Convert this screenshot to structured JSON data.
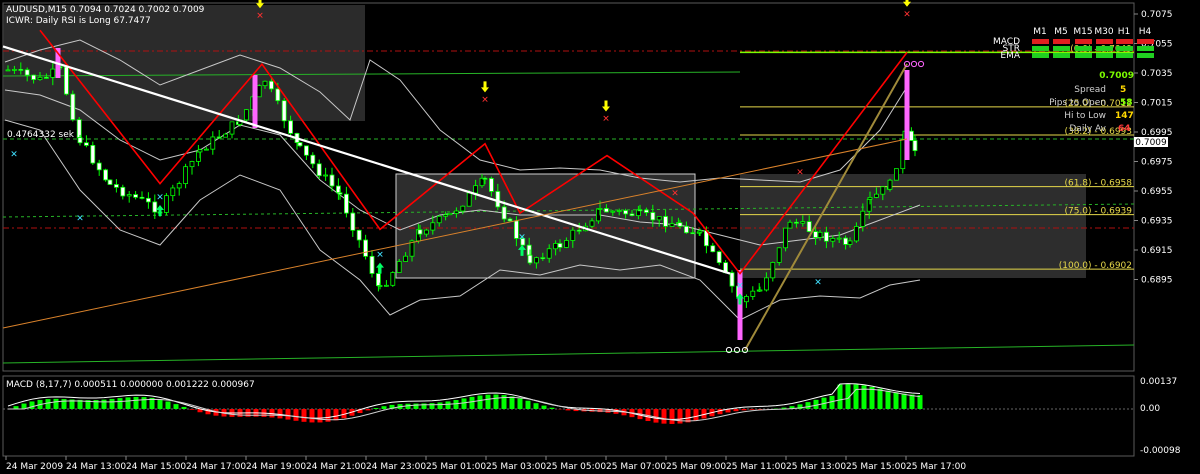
{
  "header": {
    "symbol_line": "AUDUSD,M15  0.7094 0.7024 0.7002 0.7009",
    "indicator_line": "ICWR: Daily RSI is Long 67.7477",
    "trend_label": "0.4764332 sek"
  },
  "info_panel": {
    "price": "0.7009",
    "rows": [
      {
        "label": "Spread",
        "value": "5",
        "color": "#ffd700"
      },
      {
        "label": "Pips to Open",
        "value": "58",
        "color": "#7cfc00"
      },
      {
        "label": "Hi to Low",
        "value": "147",
        "color": "#ffd700"
      },
      {
        "label": "Daily Av",
        "value": "64",
        "color": "#ff3b3b"
      }
    ],
    "matrix_cols": [
      "M1",
      "M5",
      "M15",
      "M30",
      "H1",
      "H4"
    ],
    "matrix_rows": [
      {
        "name": "MACD",
        "cells": [
          "red",
          "red",
          "red",
          "red",
          "red",
          "red"
        ]
      },
      {
        "name": "STR",
        "cells": [
          "green",
          "green",
          "green",
          "green",
          "green",
          "green"
        ]
      },
      {
        "name": "EMA",
        "cells": [
          "green",
          "green",
          "green",
          "green",
          "green",
          "green"
        ]
      }
    ]
  },
  "current_price_label": "0.7009",
  "fib_levels": [
    {
      "label": "(0.0) - 0.7049",
      "price": 0.7049
    },
    {
      "label": "(25.0) - 0.7012",
      "price": 0.7012
    },
    {
      "label": "(38.2) - 0.6993",
      "price": 0.6993
    },
    {
      "label": "(61.8) - 0.6958",
      "price": 0.6958
    },
    {
      "label": "(75.0) - 0.6939",
      "price": 0.6939
    },
    {
      "label": "(100.0) - 0.6902",
      "price": 0.6902
    }
  ],
  "macd": {
    "label": "MACD (8,17,7) 0.000511 0.000000 0.001222 0.000967",
    "axis_labels": [
      "0.00137",
      "0.00",
      "-0.00098"
    ],
    "axis_values": [
      0.00137,
      0.0,
      -0.00098
    ]
  },
  "colors": {
    "up_candle": "#000000",
    "down_candle": "#ffffff",
    "zigzag": "#ff0000",
    "trendline": "#ffffff",
    "fib_level": "#e6d84a",
    "macd_pos": "#00ff00",
    "macd_neg": "#ff0000",
    "arrow_up": "#00ff66",
    "arrow_down": "#ffff00",
    "accent_price": "#7cfc00"
  },
  "chart_data": {
    "type": "candlestick",
    "symbol": "AUDUSD",
    "timeframe": "M15",
    "ohlc_last": {
      "open": 0.7094,
      "high": 0.7024,
      "low": 0.7002,
      "close": 0.7009
    },
    "y_ticks": [
      "0.7075",
      "0.7055",
      "0.7035",
      "0.7015",
      "0.6995",
      "0.6975",
      "0.6955",
      "0.6935",
      "0.6915",
      "0.6895"
    ],
    "y_tick_values": [
      0.7075,
      0.7055,
      0.7035,
      0.7015,
      0.6995,
      0.6975,
      0.6955,
      0.6935,
      0.6915,
      0.6895
    ],
    "ylim": [
      0.6888,
      0.7082
    ],
    "x_ticks": [
      "24 Mar 2009",
      "24 Mar 13:00",
      "24 Mar 15:00",
      "24 Mar 17:00",
      "24 Mar 19:00",
      "24 Mar 21:00",
      "24 Mar 23:00",
      "25 Mar 01:00",
      "25 Mar 03:00",
      "25 Mar 05:00",
      "25 Mar 07:00",
      "25 Mar 09:00",
      "25 Mar 11:00",
      "25 Mar 13:00",
      "25 Mar 15:00",
      "25 Mar 17:00"
    ],
    "zigzag_prices": [
      0.7064,
      0.696,
      0.7041,
      0.6929,
      0.6987,
      0.694,
      0.6979,
      0.694,
      0.6899,
      0.7049
    ],
    "trendline_prices": [
      0.7053,
      0.6899
    ],
    "arrows_up_prices": [
      0.6957,
      0.6918,
      0.693,
      0.6897
    ],
    "arrows_down_prices": [
      0.7066,
      0.7009,
      0.6996,
      0.7067
    ]
  }
}
